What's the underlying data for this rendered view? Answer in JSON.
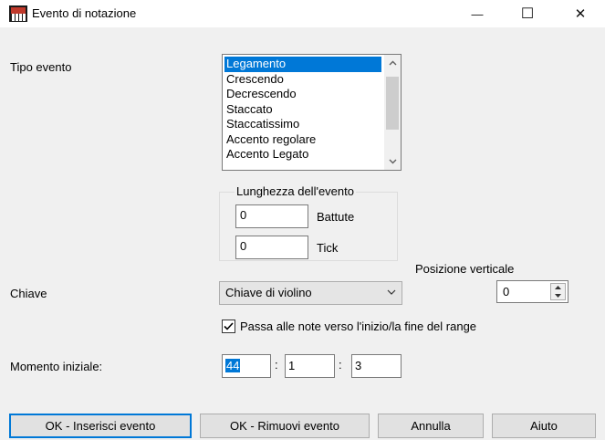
{
  "window": {
    "title": "Evento di notazione",
    "controls": {
      "minimize": "—",
      "maximize": "☐",
      "close": "✕"
    }
  },
  "event_type": {
    "label": "Tipo evento",
    "items": [
      "Legamento",
      "Crescendo",
      "Decrescendo",
      "Staccato",
      "Staccatissimo",
      "Accento regolare",
      "Accento Legato"
    ],
    "selected": "Legamento"
  },
  "length": {
    "legend": "Lunghezza dell'evento",
    "bars_value": "0",
    "bars_label": "Battute",
    "ticks_value": "0",
    "ticks_label": "Tick"
  },
  "vertical_position": {
    "label": "Posizione verticale",
    "value": "0"
  },
  "clef": {
    "label": "Chiave",
    "selected": "Chiave di violino"
  },
  "range_checkbox": {
    "label": "Passa alle note verso l'inizio/la fine del range",
    "checked": true
  },
  "start_time": {
    "label": "Momento iniziale:",
    "bar": "44",
    "beat": "1",
    "tick": "3",
    "separator": ":"
  },
  "buttons": {
    "insert": "OK - Inserisci evento",
    "remove": "OK - Rimuovi evento",
    "cancel": "Annulla",
    "help": "Aiuto"
  },
  "colors": {
    "accent": "#0078d7",
    "background": "#f0f0f0"
  }
}
